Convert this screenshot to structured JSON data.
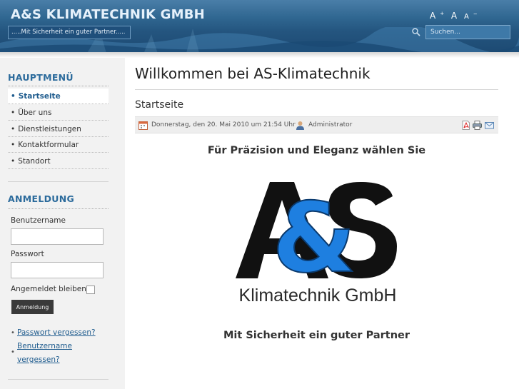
{
  "header": {
    "site_title": "A&S KLIMATECHNIK GMBH",
    "tagline": ".....Mit Sicherheit ein guter Partner.....",
    "font_increase": "A",
    "font_reset": "A",
    "font_decrease": "A",
    "search_placeholder": "Suchen..."
  },
  "sidebar": {
    "menu_heading": "HAUPTMENÜ",
    "menu_items": [
      {
        "label": "Startseite",
        "active": true
      },
      {
        "label": "Über uns",
        "active": false
      },
      {
        "label": "Dienstleistungen",
        "active": false
      },
      {
        "label": "Kontaktformular",
        "active": false
      },
      {
        "label": "Standort",
        "active": false
      }
    ],
    "login": {
      "heading": "ANMELDUNG",
      "username_label": "Benutzername",
      "password_label": "Passwort",
      "remember_label": "Angemeldet bleiben",
      "submit_label": "Anmeldung",
      "forgot_password": "Passwort vergessen?",
      "forgot_username_line1": "Benutzername",
      "forgot_username_line2": "vergessen?"
    }
  },
  "content": {
    "page_heading": "Willkommen bei AS-Klimatechnik",
    "article_title": "Startseite",
    "meta_date": "Donnerstag, den 20. Mai 2010 um 21:54 Uhr",
    "meta_author": "Administrator",
    "intro_text": "Für Präzision und Eleganz wählen Sie",
    "logo_main": "A&S",
    "logo_sub": "Klimatechnik GmbH",
    "closing_text": "Mit Sicherheit ein guter Partner"
  },
  "colors": {
    "header_blue": "#24557f",
    "link_blue": "#1f5c8e",
    "heading_blue": "#2c6b9c",
    "logo_blue": "#1e7fe0"
  },
  "icons": [
    "search-icon",
    "calendar-icon",
    "user-icon",
    "pdf-icon",
    "print-icon",
    "email-icon"
  ]
}
